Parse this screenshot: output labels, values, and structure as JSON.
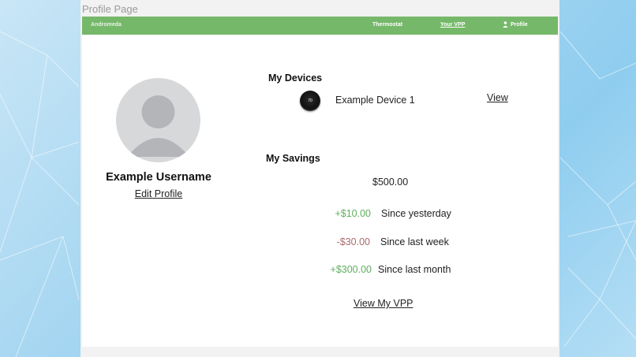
{
  "page_label": "Profile Page",
  "nav": {
    "brand": "Andromeda",
    "thermostat": "Thermostat",
    "vpp": "Your VPP",
    "profile": "Profile"
  },
  "profile": {
    "username": "Example Username",
    "edit_label": "Edit Profile"
  },
  "devices": {
    "heading": "My Devices",
    "items": [
      {
        "icon_text": "70",
        "name": "Example Device 1",
        "action": "View"
      }
    ]
  },
  "savings": {
    "heading": "My Savings",
    "total": "$500.00",
    "rows": [
      {
        "amount": "+$10.00",
        "label": "Since yesterday",
        "trend": "positive"
      },
      {
        "amount": "-$30.00",
        "label": "Since last week",
        "trend": "negative"
      },
      {
        "amount": "+$300.00",
        "label": "Since last month",
        "trend": "positive"
      }
    ],
    "link": "View My VPP"
  },
  "colors": {
    "nav_green": "#76b86a",
    "positive": "#5fae5d",
    "negative": "#a86b6b"
  }
}
